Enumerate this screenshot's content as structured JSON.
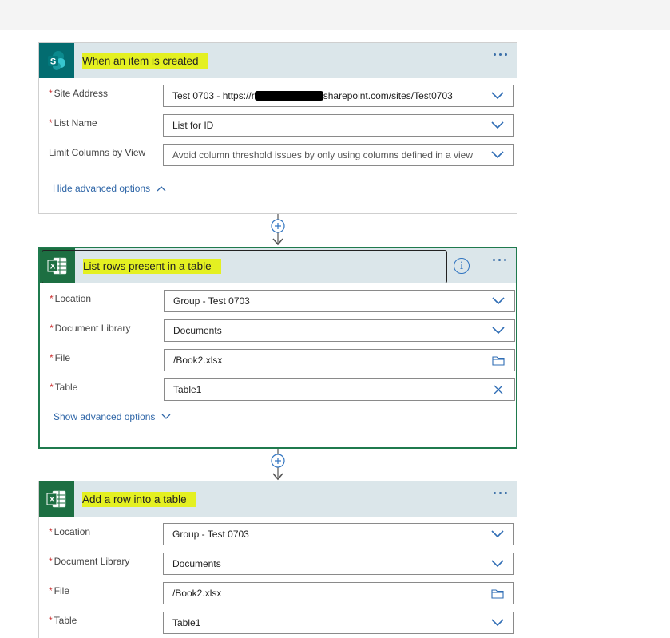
{
  "card1": {
    "title": "When an item is created",
    "icon": "sharepoint-icon",
    "fields": {
      "site_label": "Site Address",
      "site_value_prefix": "Test 0703 - https://r",
      "site_value_suffix": "sharepoint.com/sites/Test0703",
      "list_label": "List Name",
      "list_value": "List for ID",
      "view_label": "Limit Columns by View",
      "view_placeholder": "Avoid column threshold issues by only using columns defined in a view"
    },
    "advanced": "Hide advanced options"
  },
  "card2": {
    "title": "List rows present in a table",
    "icon": "excel-icon",
    "info_glyph": "i",
    "fields": {
      "location_label": "Location",
      "location_value": "Group - Test 0703",
      "library_label": "Document Library",
      "library_value": "Documents",
      "file_label": "File",
      "file_value": "/Book2.xlsx",
      "table_label": "Table",
      "table_value": "Table1"
    },
    "advanced": "Show advanced options"
  },
  "card3": {
    "title": "Add a row into a table",
    "icon": "excel-icon",
    "fields": {
      "location_label": "Location",
      "location_value": "Group - Test 0703",
      "library_label": "Document Library",
      "library_value": "Documents",
      "file_label": "File",
      "file_value": "/Book2.xlsx",
      "table_label": "Table",
      "table_value": "Table1"
    }
  },
  "required_mark": "*",
  "colors": {
    "highlight": "#e4f021",
    "header_bg": "#dbe6ea",
    "link": "#3067a8",
    "selected_border": "#1f7a4d",
    "sharepoint": "#036c70",
    "excel": "#1d6f42"
  }
}
